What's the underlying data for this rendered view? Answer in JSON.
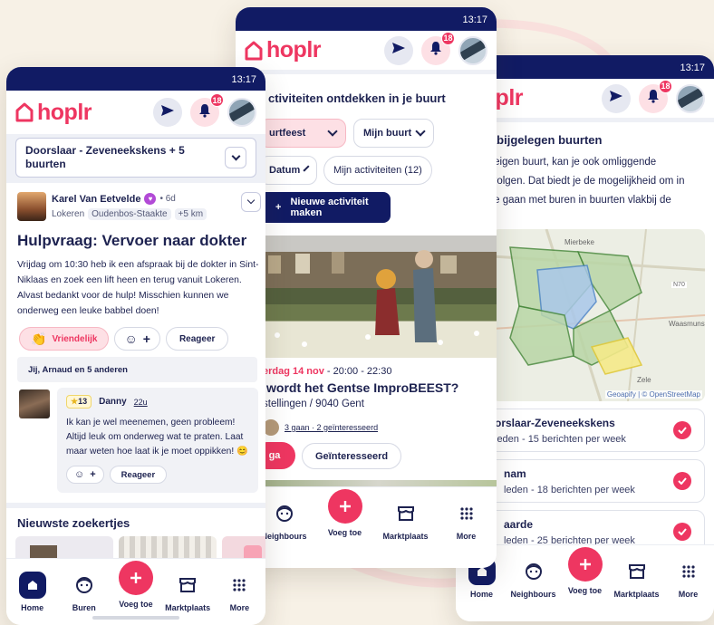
{
  "status_time": "13:17",
  "brand": {
    "logo_text": "hoplr",
    "pink": "#ee3661",
    "navy": "#111b64"
  },
  "header": {
    "notif_count": "18"
  },
  "phone1": {
    "location_select": "Doorslaar - Zeveneekskens + 5 buurten",
    "post": {
      "author": "Karel Van Eetvelde",
      "time": "• 6d",
      "place": "Lokeren",
      "neighbourhood": "Oudenbos-Staakte",
      "extra": "+5 km",
      "title": "Hulpvraag: Vervoer naar dokter",
      "body": "Vrijdag om 10:30 heb ik een afspraak bij de dokter in Sint-Niklaas en zoek een lift heen en terug vanuit Lokeren. Alvast bedankt voor de hulp! Misschien kunnen we onderweg een leuke babbel doen!",
      "reaction_label": "Vriendelijk",
      "reply_label": "Reageer",
      "likes": "Jij, Arnaud en 5 anderen"
    },
    "comment": {
      "score": "13",
      "author": "Danny",
      "time": "22u",
      "text": "Ik kan je wel meenemen, geen probleem! Altijd leuk om onderweg wat te praten. Laat maar weten hoe laat ik je moet oppikken! 😊",
      "reply_label": "Reageer"
    },
    "section_title": "Nieuwste zoekertjes",
    "nav": [
      "Home",
      "Buren",
      "Voeg toe",
      "Marktplaats",
      "More"
    ]
  },
  "phone2": {
    "title": "ctiviteiten ontdekken in je buurt",
    "filter_category": "urtfeest",
    "filter_area": "Mijn buurt",
    "filter_date": "Datum",
    "my_activities": "Mijn activiteiten (12)",
    "new_button": "Nieuwe activiteit maken",
    "event": {
      "date": "erdag 14 nov",
      "time": " - 20:00 - 22:30",
      "title": "wordt het Gentse ImproBEEST?",
      "location": "stellingen / 9040 Gent",
      "attendance": "3 gaan · 2 geïnteresseerd",
      "go_label": "ga",
      "interested_label": "Geïnteresseerd"
    },
    "nav": [
      "Neighbours",
      "Voeg toe",
      "Marktplaats",
      "More"
    ]
  },
  "phone3": {
    "title": "nabijgelegen buurten",
    "intro": "je eigen buurt, kan je ook omliggende\nn volgen. Dat biedt je de mogelijkheid om in\nk te gaan met buren in buurten vlakbij de",
    "map_attribution": "Geoapify | © OpenStreetMap",
    "map_labels": [
      "Mierbeke",
      "Zele",
      "N70",
      "Waasmunst"
    ],
    "neighbourhoods": [
      {
        "name": "orslaar-Zeveneekskens",
        "stats": "leden - 15 berichten per week"
      },
      {
        "name": "nam",
        "stats": "leden - 18 berichten per week"
      },
      {
        "name": "aarde",
        "stats": "leden - 25 berichten per week"
      }
    ],
    "nav": [
      "Home",
      "Neighbours",
      "Voeg toe",
      "Marktplaats",
      "More"
    ]
  }
}
